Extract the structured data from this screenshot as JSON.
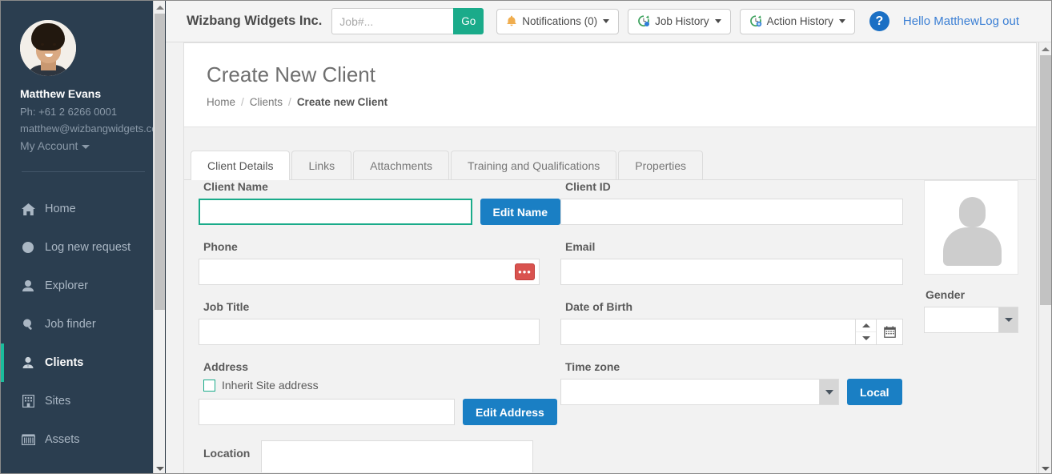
{
  "sidebar": {
    "user": {
      "name": "Matthew Evans",
      "phone": "Ph: +61 2 6266 0001",
      "email": "matthew@wizbangwidgets.co",
      "account_menu": "My Account"
    },
    "items": [
      {
        "label": "Home",
        "icon": "home-icon",
        "active": false
      },
      {
        "label": "Log new request",
        "icon": "circle-icon",
        "active": false
      },
      {
        "label": "Explorer",
        "icon": "user-icon",
        "active": false
      },
      {
        "label": "Job finder",
        "icon": "magnifier-icon",
        "active": false
      },
      {
        "label": "Clients",
        "icon": "user-tie-icon",
        "active": true
      },
      {
        "label": "Sites",
        "icon": "building-icon",
        "active": false
      },
      {
        "label": "Assets",
        "icon": "assets-icon",
        "active": false
      }
    ]
  },
  "topbar": {
    "brand": "Wizbang Widgets Inc.",
    "search_placeholder": "Job#...",
    "search_value": "",
    "go_label": "Go",
    "notifications_label": "Notifications (0)",
    "job_history_label": "Job History",
    "action_history_label": "Action History",
    "help_label": "?",
    "hello_label": "Hello Matthew",
    "logout_label": "Log out"
  },
  "page": {
    "title": "Create New Client",
    "breadcrumb": {
      "home": "Home",
      "clients": "Clients",
      "current": "Create new Client",
      "separator": "/"
    }
  },
  "tabs": [
    {
      "label": "Client Details",
      "active": true
    },
    {
      "label": "Links",
      "active": false
    },
    {
      "label": "Attachments",
      "active": false
    },
    {
      "label": "Training and Qualifications",
      "active": false
    },
    {
      "label": "Properties",
      "active": false
    }
  ],
  "form": {
    "client_name": {
      "label": "Client Name",
      "value": "",
      "button": "Edit Name"
    },
    "phone": {
      "label": "Phone",
      "value": "",
      "dots_button": "•••"
    },
    "job_title": {
      "label": "Job Title",
      "value": ""
    },
    "address": {
      "label": "Address",
      "inherit_label": "Inherit Site address",
      "inherit_checked": false,
      "value": "",
      "button": "Edit Address"
    },
    "location": {
      "label": "Location",
      "value": ""
    },
    "client_id": {
      "label": "Client ID",
      "value": ""
    },
    "email": {
      "label": "Email",
      "value": ""
    },
    "date_of_birth": {
      "label": "Date of Birth",
      "value": ""
    },
    "time_zone": {
      "label": "Time zone",
      "value": "",
      "button": "Local"
    },
    "gender": {
      "label": "Gender",
      "value": ""
    }
  },
  "colors": {
    "sidebar_bg": "#2b3e50",
    "accent_green": "#1abc9c",
    "go_green": "#1aab8a",
    "primary_blue": "#1a7fc4",
    "link_blue": "#3b7fd4",
    "danger_red": "#d9534f",
    "bell_orange": "#f0ad4e"
  }
}
